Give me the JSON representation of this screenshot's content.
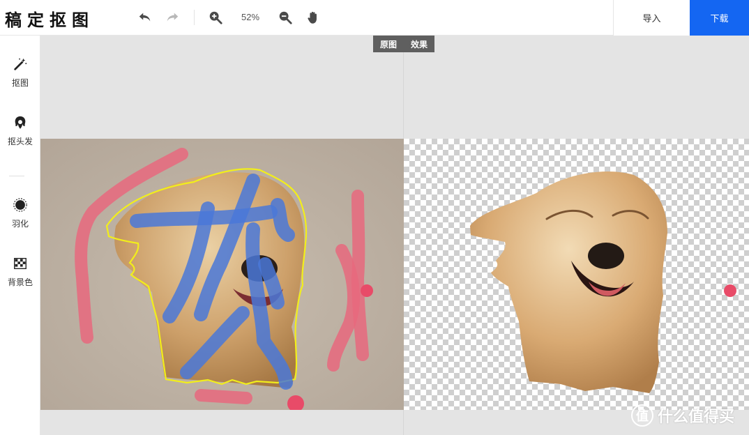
{
  "app": {
    "title": "稿定抠图"
  },
  "toolbar": {
    "undo_icon": "undo-icon",
    "redo_icon": "redo-icon",
    "zoom_in_icon": "zoom-in-icon",
    "zoom_value": "52%",
    "zoom_out_icon": "zoom-out-icon",
    "hand_icon": "hand-icon",
    "import_label": "导入",
    "download_label": "下载"
  },
  "sidebar": {
    "items": [
      {
        "label": "抠图",
        "icon": "magic-wand-icon"
      },
      {
        "label": "抠头发",
        "icon": "hair-icon"
      },
      {
        "label": "羽化",
        "icon": "feather-circle-icon"
      },
      {
        "label": "背景色",
        "icon": "background-color-icon"
      }
    ]
  },
  "canvas": {
    "view_toggle": {
      "original_label": "原图",
      "result_label": "效果"
    }
  },
  "colors": {
    "accent": "#1466f2",
    "keep_stroke": "#4a78d8",
    "remove_stroke": "#e8687e",
    "selection_outline": "#f2ee1a",
    "canvas_bg": "#e4e4e4"
  },
  "watermark": {
    "text": "什么值得买",
    "logo": "值"
  }
}
